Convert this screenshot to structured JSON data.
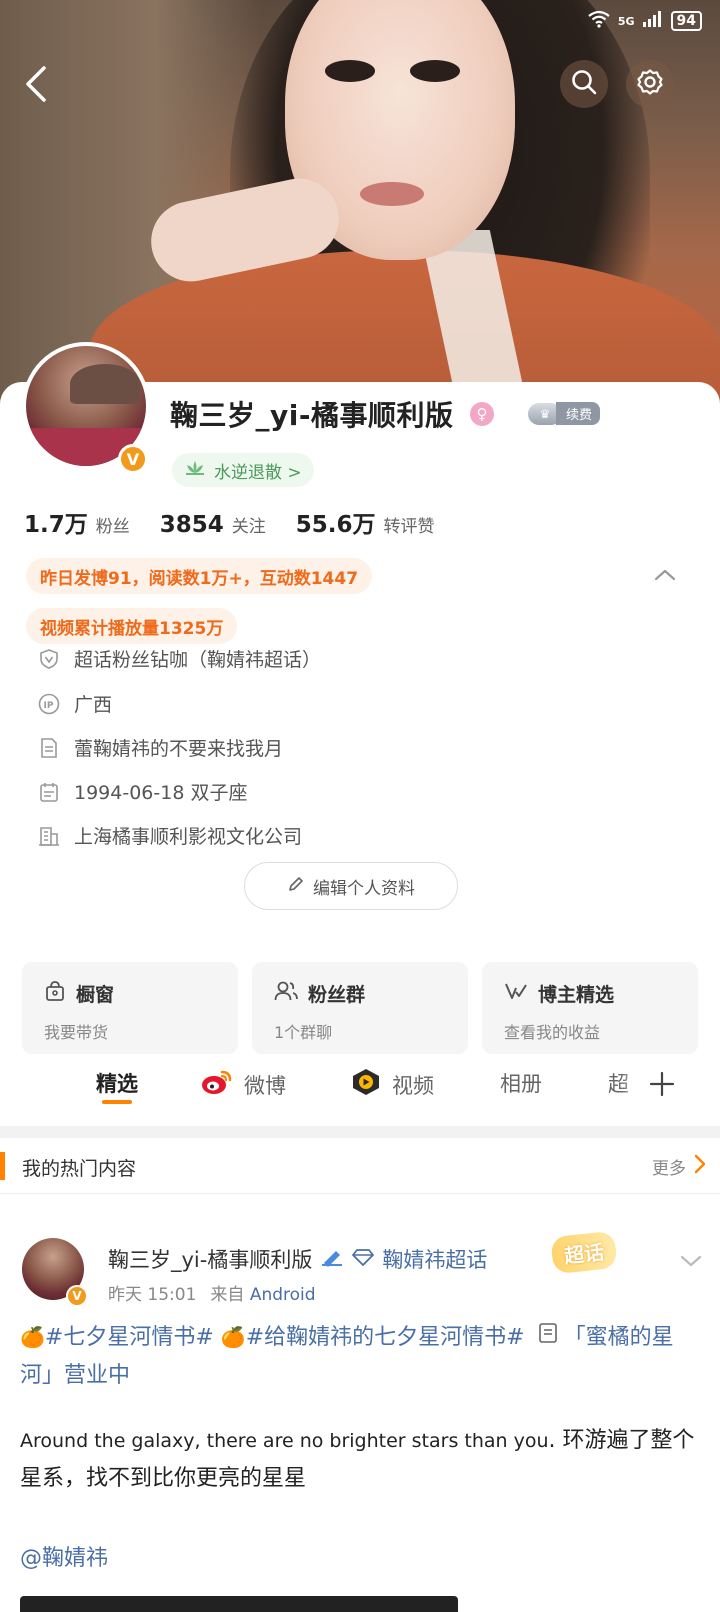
{
  "status_bar": {
    "network": "5G",
    "battery": "94"
  },
  "profile": {
    "name": "鞠三岁_yi-橘事顺利版",
    "gender_symbol": "♀",
    "vip_label": "续费",
    "verified_badge": "V",
    "tag_label": "水逆退散 >",
    "stats": [
      {
        "num": "1.7万",
        "label": "粉丝"
      },
      {
        "num": "3854",
        "label": "关注"
      },
      {
        "num": "55.6万",
        "label": "转评赞"
      }
    ],
    "highlight_1": "昨日发博91，阅读数1万+，互动数1447",
    "highlight_2": "视频累计播放量1325万",
    "info": {
      "fan_title": "超话粉丝钻咖（鞠婧祎超话）",
      "location": "广西",
      "bio": "蕾鞠婧祎的不要来找我月",
      "birthday": "1994-06-18 双子座",
      "company": "上海橘事顺利影视文化公司"
    },
    "edit_button": "编辑个人资料"
  },
  "tiles": [
    {
      "title": "橱窗",
      "sub": "我要带货",
      "icon": "shop-icon"
    },
    {
      "title": "粉丝群",
      "sub": "1个群聊",
      "icon": "group-icon"
    },
    {
      "title": "博主精选",
      "sub": "查看我的收益",
      "icon": "v-check-icon"
    }
  ],
  "tabs": {
    "featured": "精选",
    "weibo": "微博",
    "video": "视频",
    "album": "相册",
    "super": "超"
  },
  "section": {
    "title": "我的热门内容",
    "more": "更多"
  },
  "post": {
    "author": "鞠三岁_yi-橘事顺利版",
    "topic": "鞠婧祎超话",
    "badge": "超话",
    "time": "昨天 15:01",
    "source_prefix": "来自",
    "source": "Android",
    "hashtag_1": "#七夕星河情书#",
    "hashtag_2": "#给鞠婧祎的七夕星河情书#",
    "link_text": "「蜜橘的星河」营业中",
    "en_text_1": "Around the galaxy",
    "en_text_2": ", there are no brighter stars than you",
    "cn_text": ". 环游遍了整个星系，找不到比你更亮的星星",
    "mention": "@鞠婧祎"
  }
}
